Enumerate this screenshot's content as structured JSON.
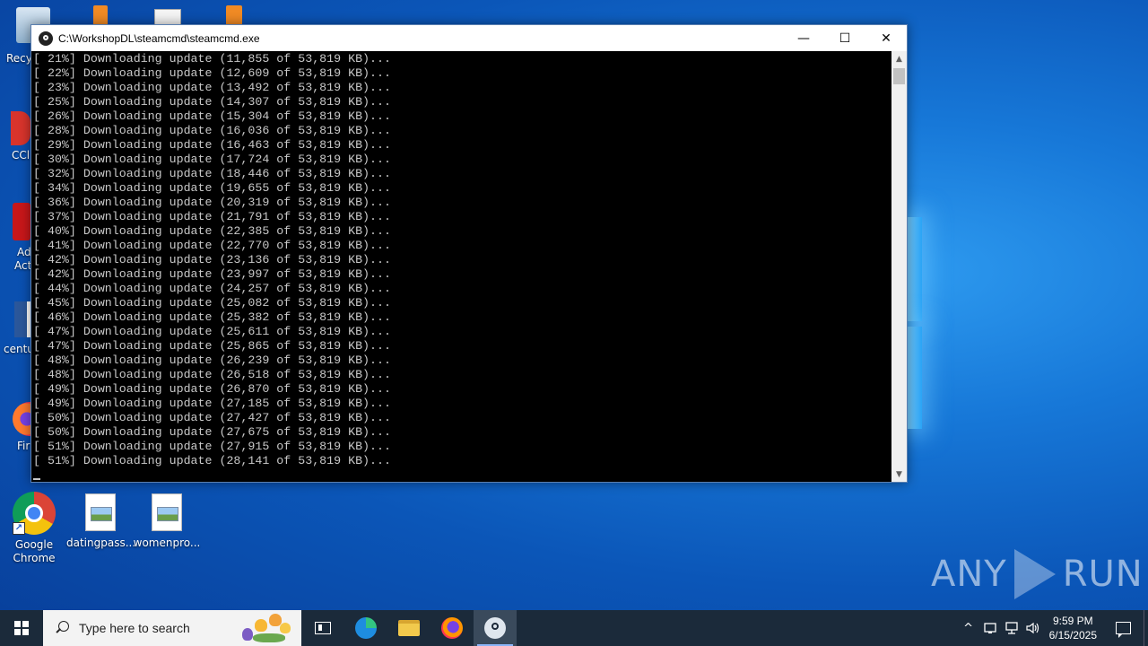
{
  "window": {
    "title": "C:\\WorkshopDL\\steamcmd\\steamcmd.exe",
    "minimize_glyph": "—",
    "maximize_glyph": "☐",
    "close_glyph": "✕"
  },
  "console": {
    "lines": [
      "[ 21%] Downloading update (11,855 of 53,819 KB)...",
      "[ 22%] Downloading update (12,609 of 53,819 KB)...",
      "[ 23%] Downloading update (13,492 of 53,819 KB)...",
      "[ 25%] Downloading update (14,307 of 53,819 KB)...",
      "[ 26%] Downloading update (15,304 of 53,819 KB)...",
      "[ 28%] Downloading update (16,036 of 53,819 KB)...",
      "[ 29%] Downloading update (16,463 of 53,819 KB)...",
      "[ 30%] Downloading update (17,724 of 53,819 KB)...",
      "[ 32%] Downloading update (18,446 of 53,819 KB)...",
      "[ 34%] Downloading update (19,655 of 53,819 KB)...",
      "[ 36%] Downloading update (20,319 of 53,819 KB)...",
      "[ 37%] Downloading update (21,791 of 53,819 KB)...",
      "[ 40%] Downloading update (22,385 of 53,819 KB)...",
      "[ 41%] Downloading update (22,770 of 53,819 KB)...",
      "[ 42%] Downloading update (23,136 of 53,819 KB)...",
      "[ 42%] Downloading update (23,997 of 53,819 KB)...",
      "[ 44%] Downloading update (24,257 of 53,819 KB)...",
      "[ 45%] Downloading update (25,082 of 53,819 KB)...",
      "[ 46%] Downloading update (25,382 of 53,819 KB)...",
      "[ 47%] Downloading update (25,611 of 53,819 KB)...",
      "[ 47%] Downloading update (25,865 of 53,819 KB)...",
      "[ 48%] Downloading update (26,239 of 53,819 KB)...",
      "[ 48%] Downloading update (26,518 of 53,819 KB)...",
      "[ 49%] Downloading update (26,870 of 53,819 KB)...",
      "[ 49%] Downloading update (27,185 of 53,819 KB)...",
      "[ 50%] Downloading update (27,427 of 53,819 KB)...",
      "[ 50%] Downloading update (27,675 of 53,819 KB)...",
      "[ 51%] Downloading update (27,915 of 53,819 KB)...",
      "[ 51%] Downloading update (28,141 of 53,819 KB)..."
    ],
    "scroll_up_glyph": "▲",
    "scroll_down_glyph": "▼"
  },
  "desktop": {
    "partial_labels": [
      "Recy",
      "CCl",
      "Ad",
      "Act",
      "centu",
      "Fir"
    ],
    "icons": [
      {
        "name": "chrome",
        "label": "Google Chrome",
        "icon": "chrome-icon"
      },
      {
        "name": "datingpass",
        "label": "datingpass...",
        "icon": "image-file-icon"
      },
      {
        "name": "womenpro",
        "label": "womenpro...",
        "icon": "image-file-icon"
      }
    ]
  },
  "watermark": {
    "left": "ANY",
    "right": "RUN"
  },
  "taskbar": {
    "search_placeholder": "Type here to search",
    "tray_chevron": "^",
    "time": "9:59 PM",
    "date": "6/15/2025"
  },
  "colors": {
    "console_bg": "#000000",
    "console_text": "#c8c8c8",
    "taskbar_bg": "#1b2a3a",
    "wallpaper": "#0b56b8"
  }
}
